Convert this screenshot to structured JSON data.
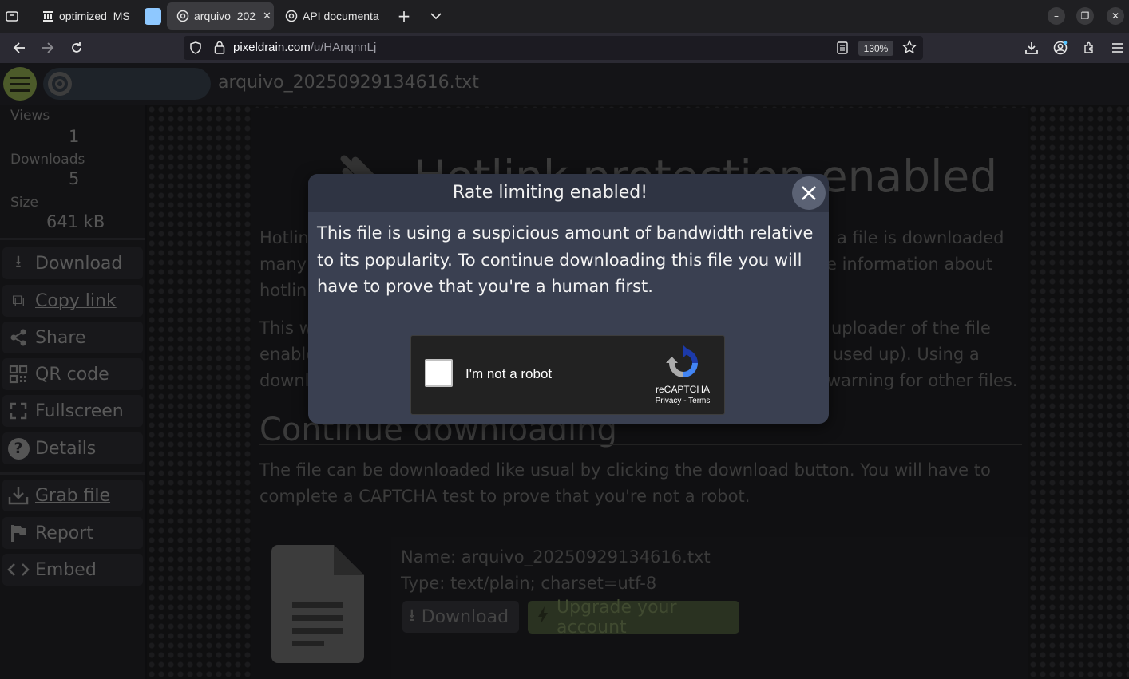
{
  "browser": {
    "tabs": [
      {
        "label": "optimized_MS",
        "icon": "bank-icon"
      },
      {
        "label": "",
        "icon": "blank-page-icon"
      },
      {
        "label": "arquivo_202",
        "icon": "pixeldrain-icon",
        "active": true
      },
      {
        "label": "API documenta",
        "icon": "pixeldrain-icon"
      }
    ],
    "url_host": "pixeldrain.com",
    "url_path": "/u/HAnqnnLj",
    "zoom": "130%"
  },
  "page": {
    "file_title": "arquivo_20250929134616.txt",
    "stats": {
      "views_label": "Views",
      "views_value": "1",
      "downloads_label": "Downloads",
      "downloads_value": "5",
      "size_label": "Size",
      "size_value": "641 kB"
    },
    "sidebar_buttons": {
      "download": "Download",
      "copy_link": "Copy link",
      "share": "Share",
      "qr_code": "QR code",
      "fullscreen": "Fullscreen",
      "details": "Details",
      "grab_file": "Grab file",
      "report": "Report",
      "embed": "Embed"
    },
    "hotlink_title": "Hotlink protection enabled",
    "hotlink_p1": [
      "Hotlin",
      "many t",
      "hotlin"
    ],
    "hotlink_p1_right": [
      "a file is downloaded",
      "e information about"
    ],
    "hotlink_p2": [
      "This w",
      "enable",
      "downl"
    ],
    "hotlink_p2_right": [
      "uploader of the file",
      "used up). Using a",
      "warning for other files."
    ],
    "continue_title": "Continue downloading",
    "continue_text": [
      "The file can be downloaded like usual by clicking the download button. You will have to",
      "complete a CAPTCHA test to prove that you're not a robot."
    ],
    "file_name": "Name: arquivo_20250929134616.txt",
    "file_type": "Type: text/plain; charset=utf-8",
    "download_btn": "Download",
    "upgrade_btn": "Upgrade your account"
  },
  "modal": {
    "title": "Rate limiting enabled!",
    "body": "This file is using a suspicious amount of bandwidth relative to its popularity. To continue downloading this file you will have to prove that you're a human first.",
    "captcha_label": "I'm not a robot",
    "captcha_brand": "reCAPTCHA",
    "captcha_links": "Privacy - Terms"
  }
}
